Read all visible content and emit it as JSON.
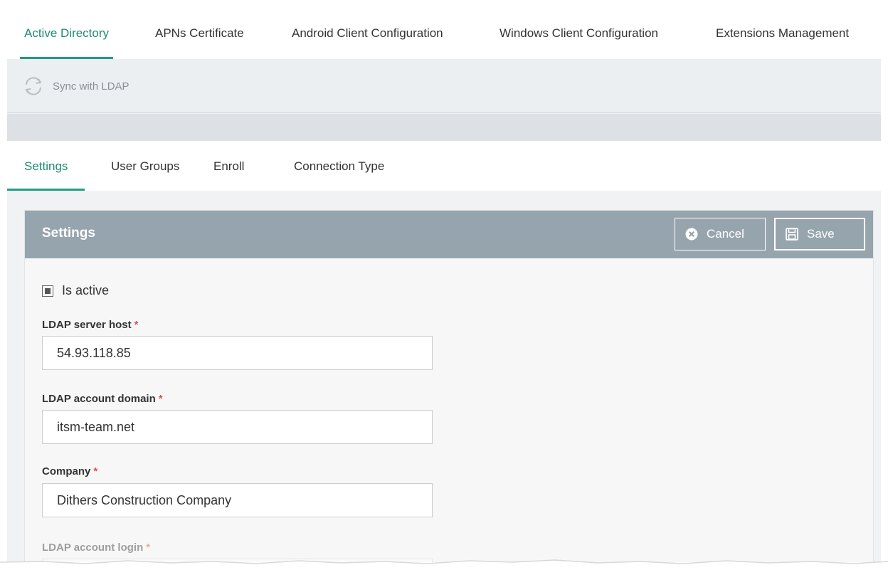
{
  "top_tabs": [
    {
      "label": "Active Directory",
      "active": true
    },
    {
      "label": "APNs Certificate",
      "active": false
    },
    {
      "label": "Android Client Configuration",
      "active": false
    },
    {
      "label": "Windows Client Configuration",
      "active": false
    },
    {
      "label": "Extensions Management",
      "active": false
    }
  ],
  "toolbar": {
    "sync_label": "Sync with LDAP",
    "sync_icon": "sync-icon"
  },
  "sub_tabs": [
    {
      "label": "Settings",
      "active": true
    },
    {
      "label": "User Groups",
      "active": false
    },
    {
      "label": "Enroll",
      "active": false
    },
    {
      "label": "Connection Type",
      "active": false
    }
  ],
  "panel": {
    "title": "Settings",
    "cancel_label": "Cancel",
    "save_label": "Save",
    "is_active_label": "Is active",
    "is_active_checked": true,
    "fields": [
      {
        "label": "LDAP server host",
        "required": "*",
        "value": "54.93.118.85"
      },
      {
        "label": "LDAP account domain",
        "required": "*",
        "value": "itsm-team.net"
      },
      {
        "label": "Company",
        "required": "*",
        "value": "Dithers Construction Company"
      },
      {
        "label": "LDAP account login",
        "required": "*",
        "value": ""
      }
    ]
  },
  "colors": {
    "accent": "#1d9f83",
    "panel_header": "#96a4ae",
    "required": "#d9534f",
    "toolbar_bg": "#eceff2"
  }
}
